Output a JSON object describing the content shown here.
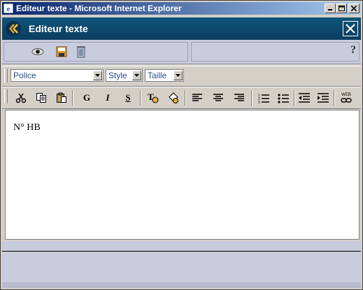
{
  "window": {
    "title": "Editeur texte - Microsoft Internet Explorer",
    "buttons": [
      "minimize",
      "maximize",
      "close"
    ]
  },
  "app": {
    "title": "Editeur texte"
  },
  "actionbar": {
    "icons": [
      "eye-icon",
      "save-icon",
      "trash-icon"
    ],
    "help": "?"
  },
  "fontbar": {
    "police": "Police",
    "style": "Style",
    "taille": "Taille"
  },
  "formatbar": {
    "bold": "G",
    "italic": "I",
    "strike": "S",
    "web": "WEB"
  },
  "editor": {
    "content": "N° HB"
  },
  "colors": {
    "header_bg": "#0e5479",
    "toolbar_bg": "#c9ccdc",
    "titlebar_start": "#0a246a"
  }
}
